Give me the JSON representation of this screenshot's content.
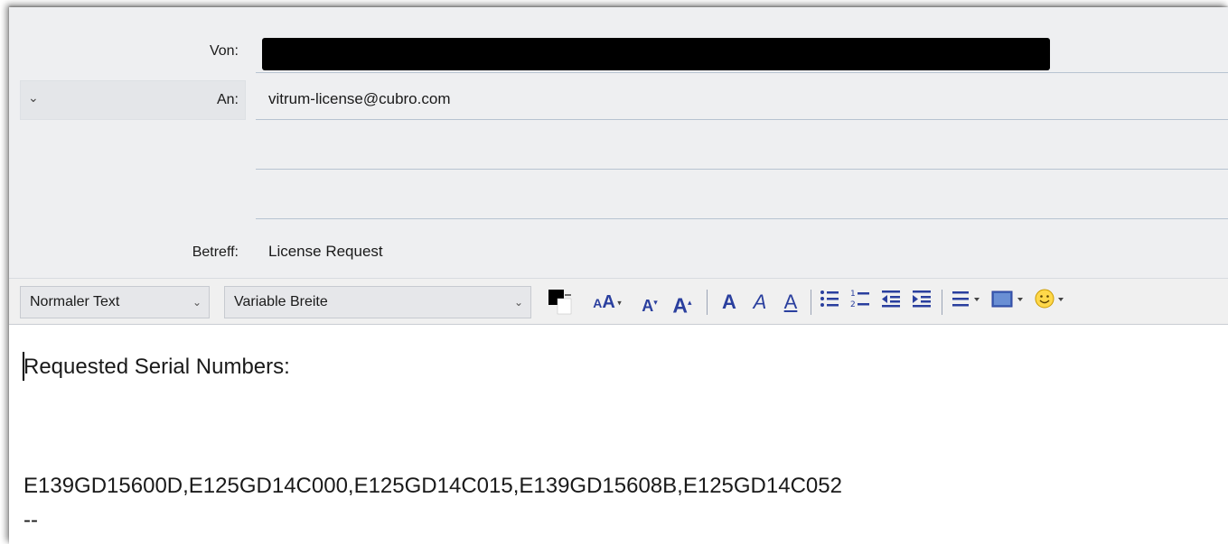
{
  "header": {
    "from_label": "Von:",
    "to_label": "An:",
    "to_value": "vitrum-license@cubro.com",
    "subject_label": "Betreff:",
    "subject_value": "License Request"
  },
  "toolbar": {
    "paragraph_format": "Normaler Text",
    "font_family": "Variable Breite",
    "icons": [
      "text-color-icon",
      "font-size-icon",
      "decrease-font-icon",
      "increase-font-icon",
      "bold-icon",
      "italic-icon",
      "underline-icon",
      "bullet-list-icon",
      "numbered-list-icon",
      "outdent-icon",
      "indent-icon",
      "align-icon",
      "insert-image-icon",
      "emoji-icon"
    ],
    "text_color": "#000000",
    "icon_color": "#2a3f9e"
  },
  "body": {
    "line1": "Requested Serial Numbers:",
    "line2": "E139GD15600D,E125GD14C000,E125GD14C015,E139GD15608B,E125GD14C052",
    "line3": "--"
  }
}
